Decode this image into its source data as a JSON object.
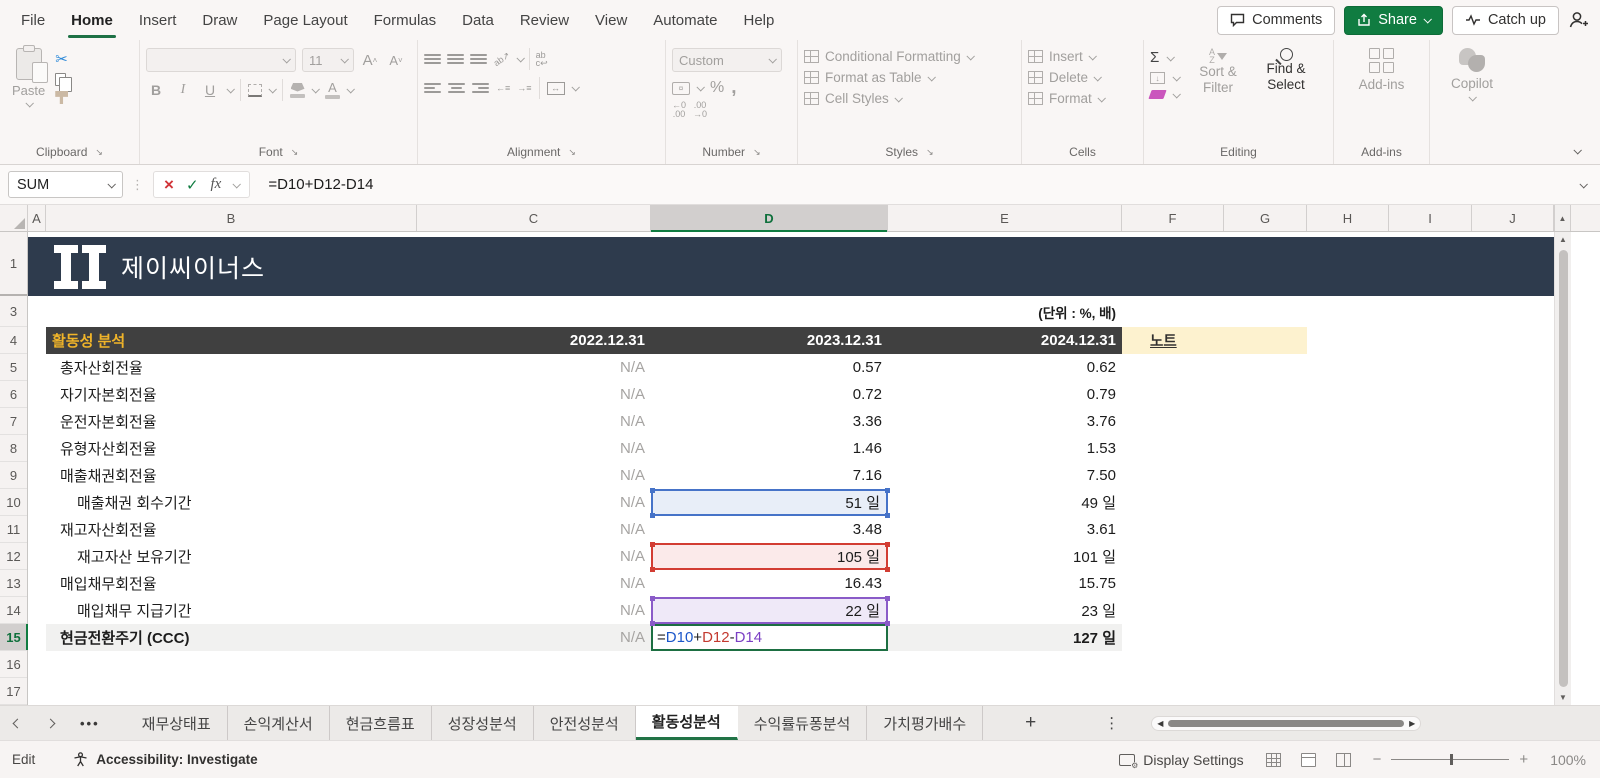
{
  "menu": {
    "tabs": [
      {
        "label": "File"
      },
      {
        "label": "Home",
        "active": true
      },
      {
        "label": "Insert"
      },
      {
        "label": "Draw"
      },
      {
        "label": "Page Layout"
      },
      {
        "label": "Formulas"
      },
      {
        "label": "Data"
      },
      {
        "label": "Review"
      },
      {
        "label": "View"
      },
      {
        "label": "Automate"
      },
      {
        "label": "Help"
      }
    ],
    "actions": {
      "comments": "Comments",
      "share": "Share",
      "catch_up": "Catch up"
    }
  },
  "ribbon": {
    "clipboard": {
      "paste": "Paste",
      "label": "Clipboard"
    },
    "font": {
      "size": "11",
      "label": "Font"
    },
    "alignment": {
      "label": "Alignment"
    },
    "number": {
      "format": "Custom",
      "label": "Number"
    },
    "styles": {
      "conditional_formatting": "Conditional Formatting",
      "format_as_table": "Format as Table",
      "cell_styles": "Cell Styles",
      "label": "Styles"
    },
    "cells": {
      "insert": "Insert",
      "delete": "Delete",
      "format": "Format",
      "label": "Cells"
    },
    "editing": {
      "sort_filter": "Sort & Filter",
      "find_select": "Find & Select",
      "label": "Editing"
    },
    "addins": {
      "button": "Add-ins",
      "label": "Add-ins"
    },
    "copilot": {
      "label": "Copilot"
    }
  },
  "formula_bar": {
    "name_box": "SUM",
    "formula": "=D10+D12-D14"
  },
  "grid": {
    "columns": [
      "A",
      "B",
      "C",
      "D",
      "E",
      "F",
      "G",
      "H",
      "I",
      "J"
    ],
    "selected_column": "D",
    "row_numbers": [
      "1",
      "3",
      "4",
      "5",
      "6",
      "7",
      "8",
      "9",
      "10",
      "11",
      "12",
      "13",
      "14",
      "15",
      "16",
      "17"
    ],
    "active_row": "15",
    "logo_text": "제이씨이너스",
    "unit_note": "(단위 : %, 배)"
  },
  "table": {
    "title": "활동성 분석",
    "year_headers": [
      "2022.12.31",
      "2023.12.31",
      "2024.12.31"
    ],
    "note_header": "노트",
    "rows": [
      {
        "label": "총자산회전율",
        "indent": false,
        "values": [
          "N/A",
          "0.57",
          "0.62"
        ]
      },
      {
        "label": "자기자본회전율",
        "indent": false,
        "values": [
          "N/A",
          "0.72",
          "0.79"
        ]
      },
      {
        "label": "운전자본회전율",
        "indent": false,
        "values": [
          "N/A",
          "3.36",
          "3.76"
        ]
      },
      {
        "label": "유형자산회전율",
        "indent": false,
        "values": [
          "N/A",
          "1.46",
          "1.53"
        ]
      },
      {
        "label": "매출채권회전율",
        "indent": false,
        "values": [
          "N/A",
          "7.16",
          "7.50"
        ]
      },
      {
        "label": "매출채권 회수기간",
        "indent": true,
        "values": [
          "N/A",
          "51 일",
          "49 일"
        ],
        "highlight": "blue"
      },
      {
        "label": "재고자산회전율",
        "indent": false,
        "values": [
          "N/A",
          "3.48",
          "3.61"
        ]
      },
      {
        "label": "재고자산 보유기간",
        "indent": true,
        "values": [
          "N/A",
          "105 일",
          "101 일"
        ],
        "highlight": "red"
      },
      {
        "label": "매입채무회전율",
        "indent": false,
        "values": [
          "N/A",
          "16.43",
          "15.75"
        ]
      },
      {
        "label": "매입채무 지급기간",
        "indent": true,
        "values": [
          "N/A",
          "22 일",
          "23 일"
        ],
        "highlight": "purple"
      },
      {
        "label": "현금전환주기 (CCC)",
        "indent": false,
        "bold": true,
        "shaded": true,
        "editing": true,
        "values": [
          "N/A",
          null,
          "127 일"
        ]
      }
    ],
    "formula_cell": {
      "parts": [
        {
          "text": "=",
          "color": "#222222"
        },
        {
          "text": "D10",
          "color": "#1a56c9"
        },
        {
          "text": "+",
          "color": "#222222"
        },
        {
          "text": "D12",
          "color": "#c3392f"
        },
        {
          "text": "-",
          "color": "#222222"
        },
        {
          "text": "D14",
          "color": "#7b3fc4"
        }
      ]
    },
    "highlight_colors": {
      "blue": {
        "border": "#4673c8",
        "fill": "#e8eef8"
      },
      "red": {
        "border": "#d23d33",
        "fill": "#fbeaea"
      },
      "purple": {
        "border": "#8a5bc8",
        "fill": "#efe9f8"
      },
      "edit_border": "#1d6f42"
    }
  },
  "sheet_tabs": {
    "tabs": [
      {
        "label": "재무상태표"
      },
      {
        "label": "손익계산서"
      },
      {
        "label": "현금흐름표"
      },
      {
        "label": "성장성분석"
      },
      {
        "label": "안전성분석"
      },
      {
        "label": "활동성분석",
        "active": true
      },
      {
        "label": "수익률듀퐁분석"
      },
      {
        "label": "가치평가배수"
      }
    ]
  },
  "status_bar": {
    "mode": "Edit",
    "accessibility": "Accessibility: Investigate",
    "display_settings": "Display Settings",
    "zoom_level": "100%"
  },
  "colors": {
    "accent_green": "#107c41",
    "banner_navy": "#2e3b4d",
    "table_header_gray": "#404040",
    "table_title_gold": "#f0b429",
    "note_cream": "#fdf2cf"
  }
}
